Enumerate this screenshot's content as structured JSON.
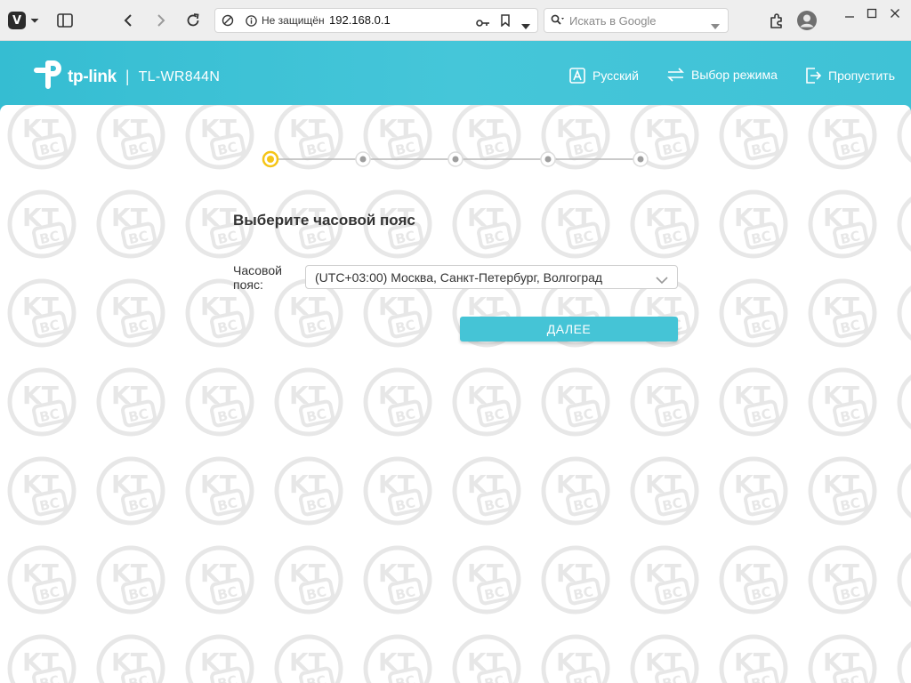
{
  "browser": {
    "address": {
      "security_text": "Не защищён",
      "url": "192.168.0.1"
    },
    "search": {
      "placeholder": "Искать в Google"
    }
  },
  "header": {
    "brand": "tp-link",
    "separator": "|",
    "model": "TL-WR844N",
    "nav": {
      "language": "Русский",
      "mode": "Выбор режима",
      "skip": "Пропустить"
    }
  },
  "wizard": {
    "steps_total": 5,
    "current_step": 1,
    "title": "Выберите часовой пояс",
    "timezone_label": "Часовой пояс:",
    "timezone_value": "(UTC+03:00) Москва, Санкт-Петербург, Волгоград",
    "next_button": "ДАЛЕЕ"
  },
  "watermark": {
    "top": "KT",
    "bottom": "BC"
  },
  "colors": {
    "header": "#45c6d9",
    "accent": "#45c4d6",
    "active_step": "#f5c518"
  }
}
